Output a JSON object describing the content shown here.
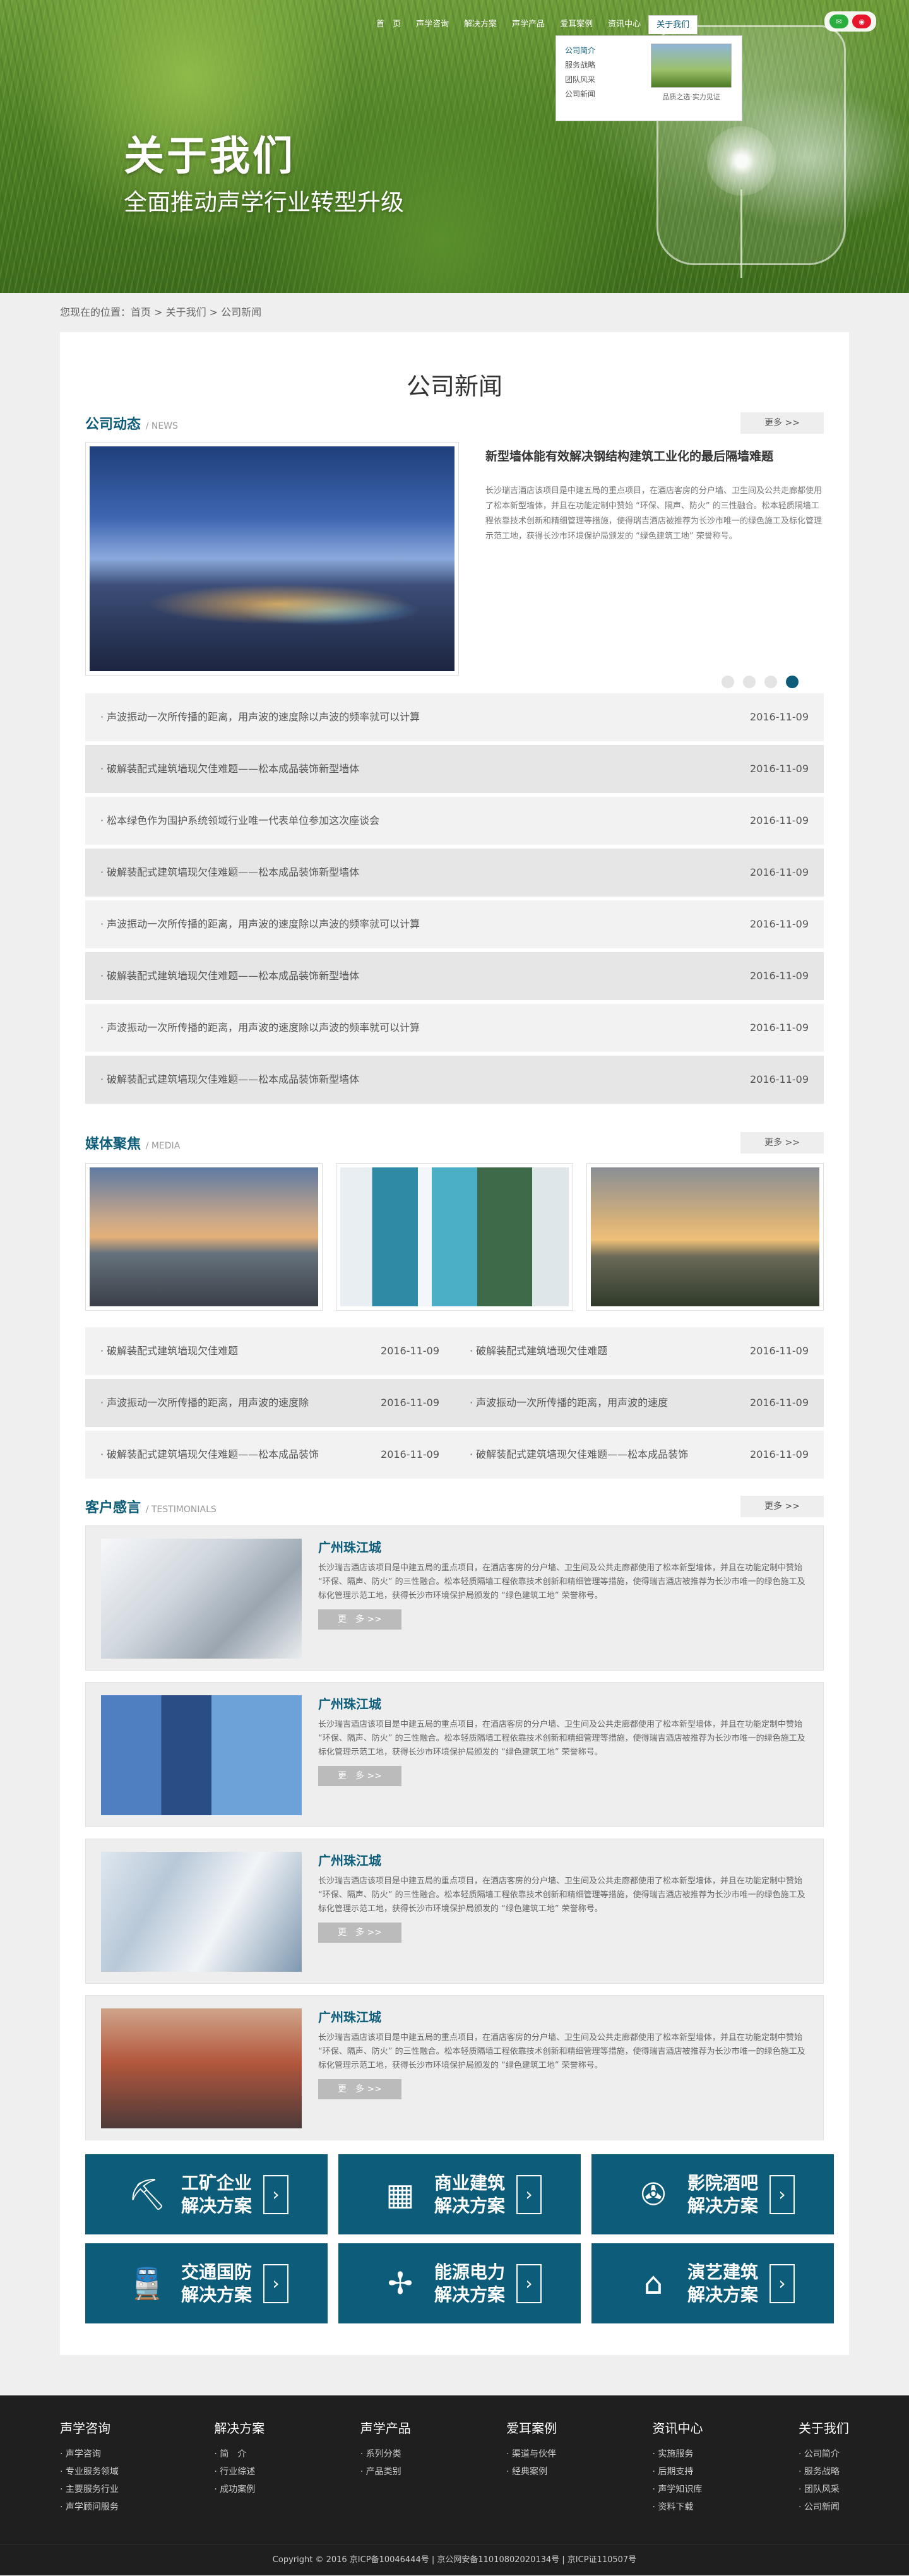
{
  "nav": {
    "items": [
      "首　页",
      "声学咨询",
      "解决方案",
      "声学产品",
      "爱耳案例",
      "资讯中心",
      "关于我们"
    ],
    "social": [
      "wechat-icon",
      "weibo-icon"
    ]
  },
  "dropdown": {
    "items": [
      "公司简介",
      "服务战略",
      "团队风采",
      "公司新闻"
    ],
    "caption": "品质之选·实力见证"
  },
  "hero": {
    "title": "关于我们",
    "subtitle": "全面推动声学行业转型升级"
  },
  "breadcrumb": "您现在的位置：首页 > 关于我们 > 公司新闻",
  "page_title": "公司新闻",
  "news": {
    "title": "公司动态",
    "title_en": "/ NEWS",
    "more": "更多 >>",
    "featured": {
      "title": "新型墙体能有效解决钢结构建筑工业化的最后隔墙难题",
      "body": "长沙瑞吉酒店该项目是中建五局的重点项目，在酒店客房的分户墙、卫生间及公共走廊都使用了松本新型墙体，并且在功能定制中赞始 “环保、隔声、防火” 的三性融合。松本轻质隔墙工程依靠技术创新和精细管理等措施，使得瑞吉酒店被推荐为长沙市唯一的绿色施工及标化管理示范工地，获得长沙市环境保护局颁发的 “绿色建筑工地” 荣誉称号。"
    },
    "rows": [
      {
        "title": "· 声波振动一次所传播的距离，用声波的速度除以声波的频率就可以计算",
        "date": "2016-11-09"
      },
      {
        "title": "· 破解装配式建筑墙现欠佳难题——松本成品装饰新型墙体",
        "date": "2016-11-09"
      },
      {
        "title": "· 松本绿色作为围护系统领域行业唯一代表单位参加这次座谈会",
        "date": "2016-11-09"
      },
      {
        "title": "· 破解装配式建筑墙现欠佳难题——松本成品装饰新型墙体",
        "date": "2016-11-09"
      },
      {
        "title": "· 声波振动一次所传播的距离，用声波的速度除以声波的频率就可以计算",
        "date": "2016-11-09"
      },
      {
        "title": "· 破解装配式建筑墙现欠佳难题——松本成品装饰新型墙体",
        "date": "2016-11-09"
      },
      {
        "title": "· 声波振动一次所传播的距离，用声波的速度除以声波的频率就可以计算",
        "date": "2016-11-09"
      },
      {
        "title": "· 破解装配式建筑墙现欠佳难题——松本成品装饰新型墙体",
        "date": "2016-11-09"
      }
    ]
  },
  "media": {
    "title": "媒体聚焦",
    "title_en": "/ MEDIA",
    "more": "更多 >>",
    "rows": [
      [
        {
          "title": "· 破解装配式建筑墙现欠佳难题",
          "date": "2016-11-09"
        },
        {
          "title": "· 破解装配式建筑墙现欠佳难题",
          "date": "2016-11-09"
        }
      ],
      [
        {
          "title": "· 声波振动一次所传播的距离，用声波的速度除",
          "date": "2016-11-09"
        },
        {
          "title": "· 声波振动一次所传播的距离，用声波的速度",
          "date": "2016-11-09"
        }
      ],
      [
        {
          "title": "· 破解装配式建筑墙现欠佳难题——松本成品装饰",
          "date": "2016-11-09"
        },
        {
          "title": "· 破解装配式建筑墙现欠佳难题——松本成品装饰",
          "date": "2016-11-09"
        }
      ]
    ]
  },
  "testimonials": {
    "title": "客户感言",
    "title_en": "/ TESTIMONIALS",
    "more": "更多 >>",
    "items": [
      {
        "name": "广州珠江城",
        "body": "长沙瑞吉酒店该项目是中建五局的重点项目，在酒店客房的分户墙、卫生间及公共走廊都使用了松本新型墙体，并且在功能定制中赞始 “环保、隔声、防火” 的三性融合。松本轻质隔墙工程依靠技术创新和精细管理等措施，使得瑞吉酒店被推荐为长沙市唯一的绿色施工及标化管理示范工地，获得长沙市环境保护局颁发的 “绿色建筑工地” 荣誉称号。",
        "more": "更　多 >>"
      },
      {
        "name": "广州珠江城",
        "body": "长沙瑞吉酒店该项目是中建五局的重点项目，在酒店客房的分户墙、卫生间及公共走廊都使用了松本新型墙体，并且在功能定制中赞始 “环保、隔声、防火” 的三性融合。松本轻质隔墙工程依靠技术创新和精细管理等措施，使得瑞吉酒店被推荐为长沙市唯一的绿色施工及标化管理示范工地，获得长沙市环境保护局颁发的 “绿色建筑工地” 荣誉称号。",
        "more": "更　多 >>"
      },
      {
        "name": "广州珠江城",
        "body": "长沙瑞吉酒店该项目是中建五局的重点项目，在酒店客房的分户墙、卫生间及公共走廊都使用了松本新型墙体，并且在功能定制中赞始 “环保、隔声、防火” 的三性融合。松本轻质隔墙工程依靠技术创新和精细管理等措施，使得瑞吉酒店被推荐为长沙市唯一的绿色施工及标化管理示范工地，获得长沙市环境保护局颁发的 “绿色建筑工地” 荣誉称号。",
        "more": "更　多 >>"
      },
      {
        "name": "广州珠江城",
        "body": "长沙瑞吉酒店该项目是中建五局的重点项目，在酒店客房的分户墙、卫生间及公共走廊都使用了松本新型墙体，并且在功能定制中赞始 “环保、隔声、防火” 的三性融合。松本轻质隔墙工程依靠技术创新和精细管理等措施，使得瑞吉酒店被推荐为长沙市唯一的绿色施工及标化管理示范工地，获得长沙市环境保护局颁发的 “绿色建筑工地” 荣誉称号。",
        "more": "更　多 >>"
      }
    ]
  },
  "solutions": [
    {
      "line1": "工矿企业",
      "line2": "解决方案",
      "icon": "excavator-icon"
    },
    {
      "line1": "商业建筑",
      "line2": "解决方案",
      "icon": "building-icon"
    },
    {
      "line1": "影院酒吧",
      "line2": "解决方案",
      "icon": "film-reel-icon"
    },
    {
      "line1": "交通国防",
      "line2": "解决方案",
      "icon": "train-icon"
    },
    {
      "line1": "能源电力",
      "line2": "解决方案",
      "icon": "wind-turbine-icon"
    },
    {
      "line1": "演艺建筑",
      "line2": "解决方案",
      "icon": "theater-icon"
    }
  ],
  "footer": {
    "columns": [
      {
        "title": "声学咨询",
        "items": [
          "· 声学咨询",
          "· 专业服务领域",
          "· 主要服务行业",
          "· 声学顾问服务"
        ]
      },
      {
        "title": "解决方案",
        "items": [
          "· 简　介",
          "· 行业综述",
          "· 成功案例"
        ]
      },
      {
        "title": "声学产品",
        "items": [
          "· 系列分类",
          "· 产品类别"
        ]
      },
      {
        "title": "爱耳案例",
        "items": [
          "· 渠道与伙伴",
          "· 经典案例"
        ]
      },
      {
        "title": "资讯中心",
        "items": [
          "· 实施服务",
          "· 后期支持",
          "· 声学知识库",
          "· 资料下载"
        ]
      },
      {
        "title": "关于我们",
        "items": [
          "· 公司简介",
          "· 服务战略",
          "· 团队风采",
          "· 公司新闻"
        ]
      }
    ],
    "copyright": "Copyright © 2016  京ICP备10046444号 | 京公网安备11010802020134号 | 京ICP证110507号"
  },
  "colors": {
    "accent": "#0d5d7a",
    "footer_bg": "#1f1f1f"
  }
}
